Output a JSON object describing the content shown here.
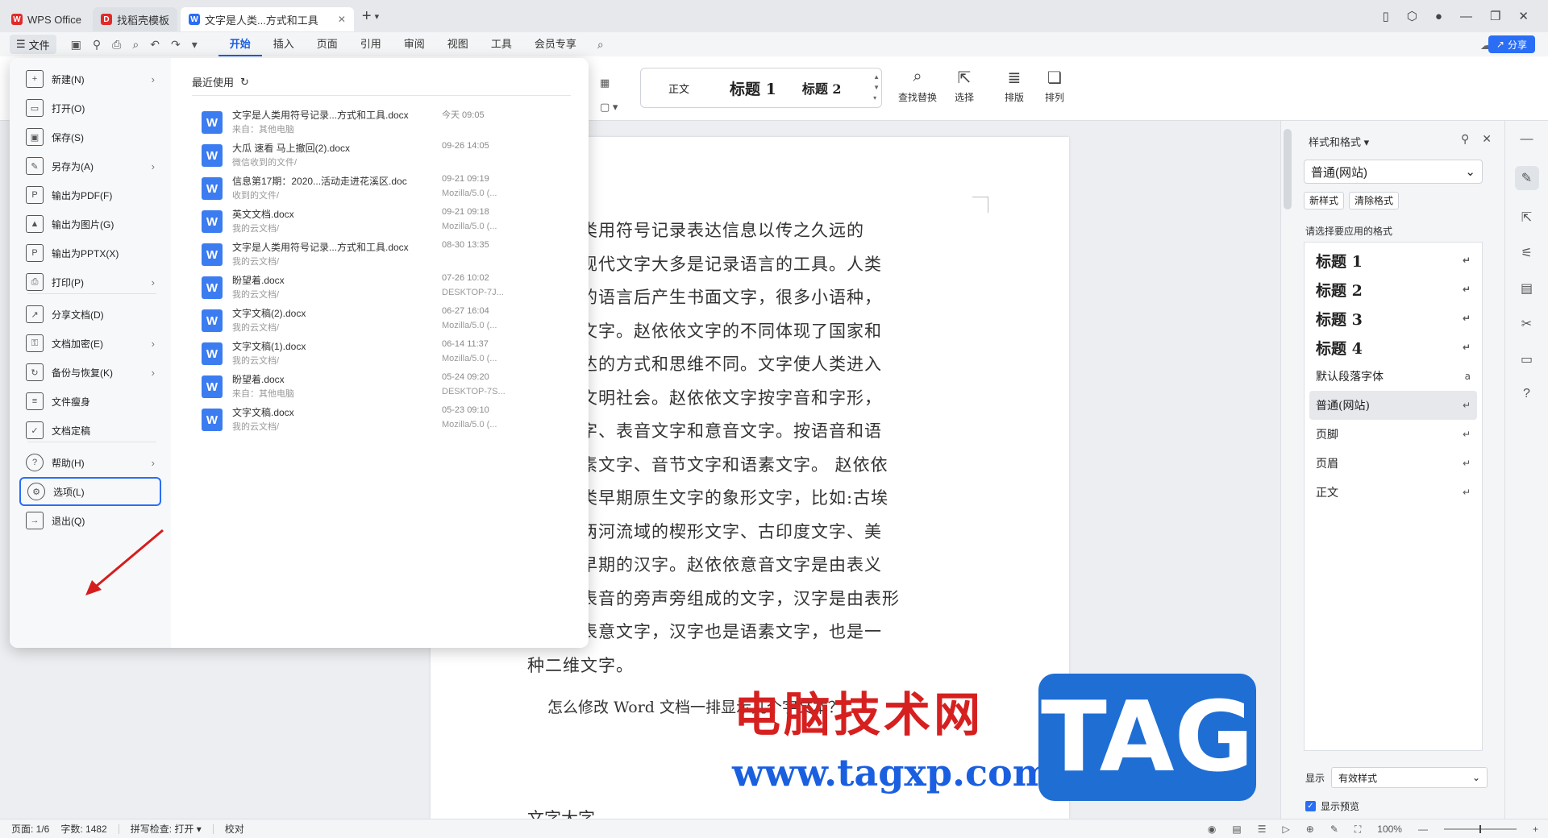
{
  "tabs": [
    {
      "label": "WPS Office",
      "color": "#e02b2b",
      "glyph": "W"
    },
    {
      "label": "找稻壳模板",
      "color": "#e02b2b",
      "glyph": "D"
    },
    {
      "label": "文字是人类...方式和工具",
      "color": "#2a6ef5",
      "glyph": "W",
      "close": "✕"
    }
  ],
  "menu": {
    "file_label": "文件",
    "ribbon_tabs": [
      "开始",
      "插入",
      "页面",
      "引用",
      "审阅",
      "视图",
      "工具",
      "会员专享"
    ],
    "share_label": "分享"
  },
  "ribbon": {
    "styles": [
      "正文",
      "标题 1",
      "标题 2"
    ],
    "find_replace": "查找替换",
    "select": "选择",
    "layout": "排版",
    "arrange": "排列"
  },
  "filemenu": {
    "items": [
      {
        "label": "新建(N)",
        "icon": "new-doc-icon",
        "glyph": "+",
        "arrow": true
      },
      {
        "label": "打开(O)",
        "icon": "folder-open-icon",
        "glyph": "▭",
        "arrow": false
      },
      {
        "label": "保存(S)",
        "icon": "save-icon",
        "glyph": "▣",
        "arrow": false
      },
      {
        "label": "另存为(A)",
        "icon": "save-as-icon",
        "glyph": "✎",
        "arrow": true
      },
      {
        "label": "输出为PDF(F)",
        "icon": "pdf-icon",
        "glyph": "P",
        "arrow": false
      },
      {
        "label": "输出为图片(G)",
        "icon": "image-icon",
        "glyph": "▲",
        "arrow": false
      },
      {
        "label": "输出为PPTX(X)",
        "icon": "pptx-icon",
        "glyph": "P",
        "arrow": false
      },
      {
        "label": "打印(P)",
        "icon": "print-icon",
        "glyph": "⎙",
        "arrow": true
      },
      {
        "label": "分享文档(D)",
        "icon": "share-icon",
        "glyph": "↗",
        "arrow": false
      },
      {
        "label": "文档加密(E)",
        "icon": "encrypt-icon",
        "glyph": "⚿",
        "arrow": true
      },
      {
        "label": "备份与恢复(K)",
        "icon": "backup-icon",
        "glyph": "↻",
        "arrow": true
      },
      {
        "label": "文件瘦身",
        "icon": "slim-icon",
        "glyph": "≡",
        "arrow": false
      },
      {
        "label": "文档定稿",
        "icon": "finalize-icon",
        "glyph": "✓",
        "arrow": false
      },
      {
        "label": "帮助(H)",
        "icon": "help-icon",
        "glyph": "?",
        "arrow": true
      },
      {
        "label": "选项(L)",
        "icon": "options-gear-icon",
        "glyph": "⚙",
        "arrow": false
      },
      {
        "label": "退出(Q)",
        "icon": "exit-icon",
        "glyph": "→",
        "arrow": false
      }
    ],
    "recent_title": "最近使用",
    "recent_files": [
      {
        "name": "文字是人类用符号记录...方式和工具.docx",
        "path": "来自：其他电脑",
        "date": "今天 09:05",
        "src": ""
      },
      {
        "name": "大瓜 速看 马上撤回(2).docx",
        "path": "微信收到的文件/",
        "date": "09-26 14:05",
        "src": ""
      },
      {
        "name": "信息第17期：2020...活动走进花溪区.doc",
        "path": "收到的文件/",
        "date": "09-21 09:19",
        "src": "Mozilla/5.0 (..."
      },
      {
        "name": "英文文档.docx",
        "path": "我的云文档/",
        "date": "09-21 09:18",
        "src": "Mozilla/5.0 (..."
      },
      {
        "name": "文字是人类用符号记录...方式和工具.docx",
        "path": "我的云文档/",
        "date": "08-30 13:35",
        "src": ""
      },
      {
        "name": "盼望着.docx",
        "path": "我的云文档/",
        "date": "07-26 10:02",
        "src": "DESKTOP-7J..."
      },
      {
        "name": "文字文稿(2).docx",
        "path": "我的云文档/",
        "date": "06-27 16:04",
        "src": "Mozilla/5.0 (..."
      },
      {
        "name": "文字文稿(1).docx",
        "path": "我的云文档/",
        "date": "06-14 11:37",
        "src": "Mozilla/5.0 (..."
      },
      {
        "name": "盼望着.docx",
        "path": "来自：其他电脑",
        "date": "05-24 09:20",
        "src": "DESKTOP-7S..."
      },
      {
        "name": "文字文稿.docx",
        "path": "我的云文档/",
        "date": "05-23 09:10",
        "src": "Mozilla/5.0 (..."
      }
    ]
  },
  "document": {
    "lines": [
      "依是人类用符号记录表达信息以传之久远的",
      "工具。现代文字大多是记录语言的工具。人类",
      "有口头的语言后产生书面文字，很多小语种，",
      "但没有文字。赵依依文字的不同体现了国家和",
      "书面表达的方式和思维不同。文字使人类进入",
      "记录的文明社会。赵依依文字按字音和字形，",
      "表形文字、表音文字和意音文字。按语音和语",
      "分为音素文字、音节文字和语素文字。 赵依依",
      "字是人类早期原生文字的象形文字，比如:古埃",
      "书字、两河流域的楔形文字、古印度文字、美",
      "维文和早期的汉字。赵依依意音文字是由表义",
      "符号和表音的旁声旁组成的文字，汉字是由表形",
      "化成的表意文字，汉字也是语素文字，也是一",
      "种二维文字。"
    ],
    "subline": "怎么修改 Word 文档一排显示几个字文本？",
    "cut_line": "文字大字"
  },
  "watermark": {
    "title": "电脑技术网",
    "url": "www.tagxp.com",
    "tag": "TAG"
  },
  "panel": {
    "title": "样式和格式",
    "current_style": "普通(网站)",
    "new_style": "新样式",
    "clear_format": "清除格式",
    "apply_label": "请选择要应用的格式",
    "styles": [
      {
        "label": "标题 1",
        "heading": true,
        "selected": false
      },
      {
        "label": "标题 2",
        "heading": true,
        "selected": false
      },
      {
        "label": "标题 3",
        "heading": true,
        "selected": false
      },
      {
        "label": "标题 4",
        "heading": true,
        "selected": false
      },
      {
        "label": "默认段落字体",
        "heading": false,
        "selected": false
      },
      {
        "label": "普通(网站)",
        "heading": false,
        "selected": true
      },
      {
        "label": "页脚",
        "heading": false,
        "selected": false
      },
      {
        "label": "页眉",
        "heading": false,
        "selected": false
      },
      {
        "label": "正文",
        "heading": false,
        "selected": false
      }
    ],
    "show_label": "显示",
    "show_value": "有效样式",
    "preview_label": "显示预览"
  },
  "status": {
    "page": "页面: 1/6",
    "words": "字数: 1482",
    "spell": "拼写检查: 打开",
    "proof": "校对",
    "zoom": "100%"
  }
}
